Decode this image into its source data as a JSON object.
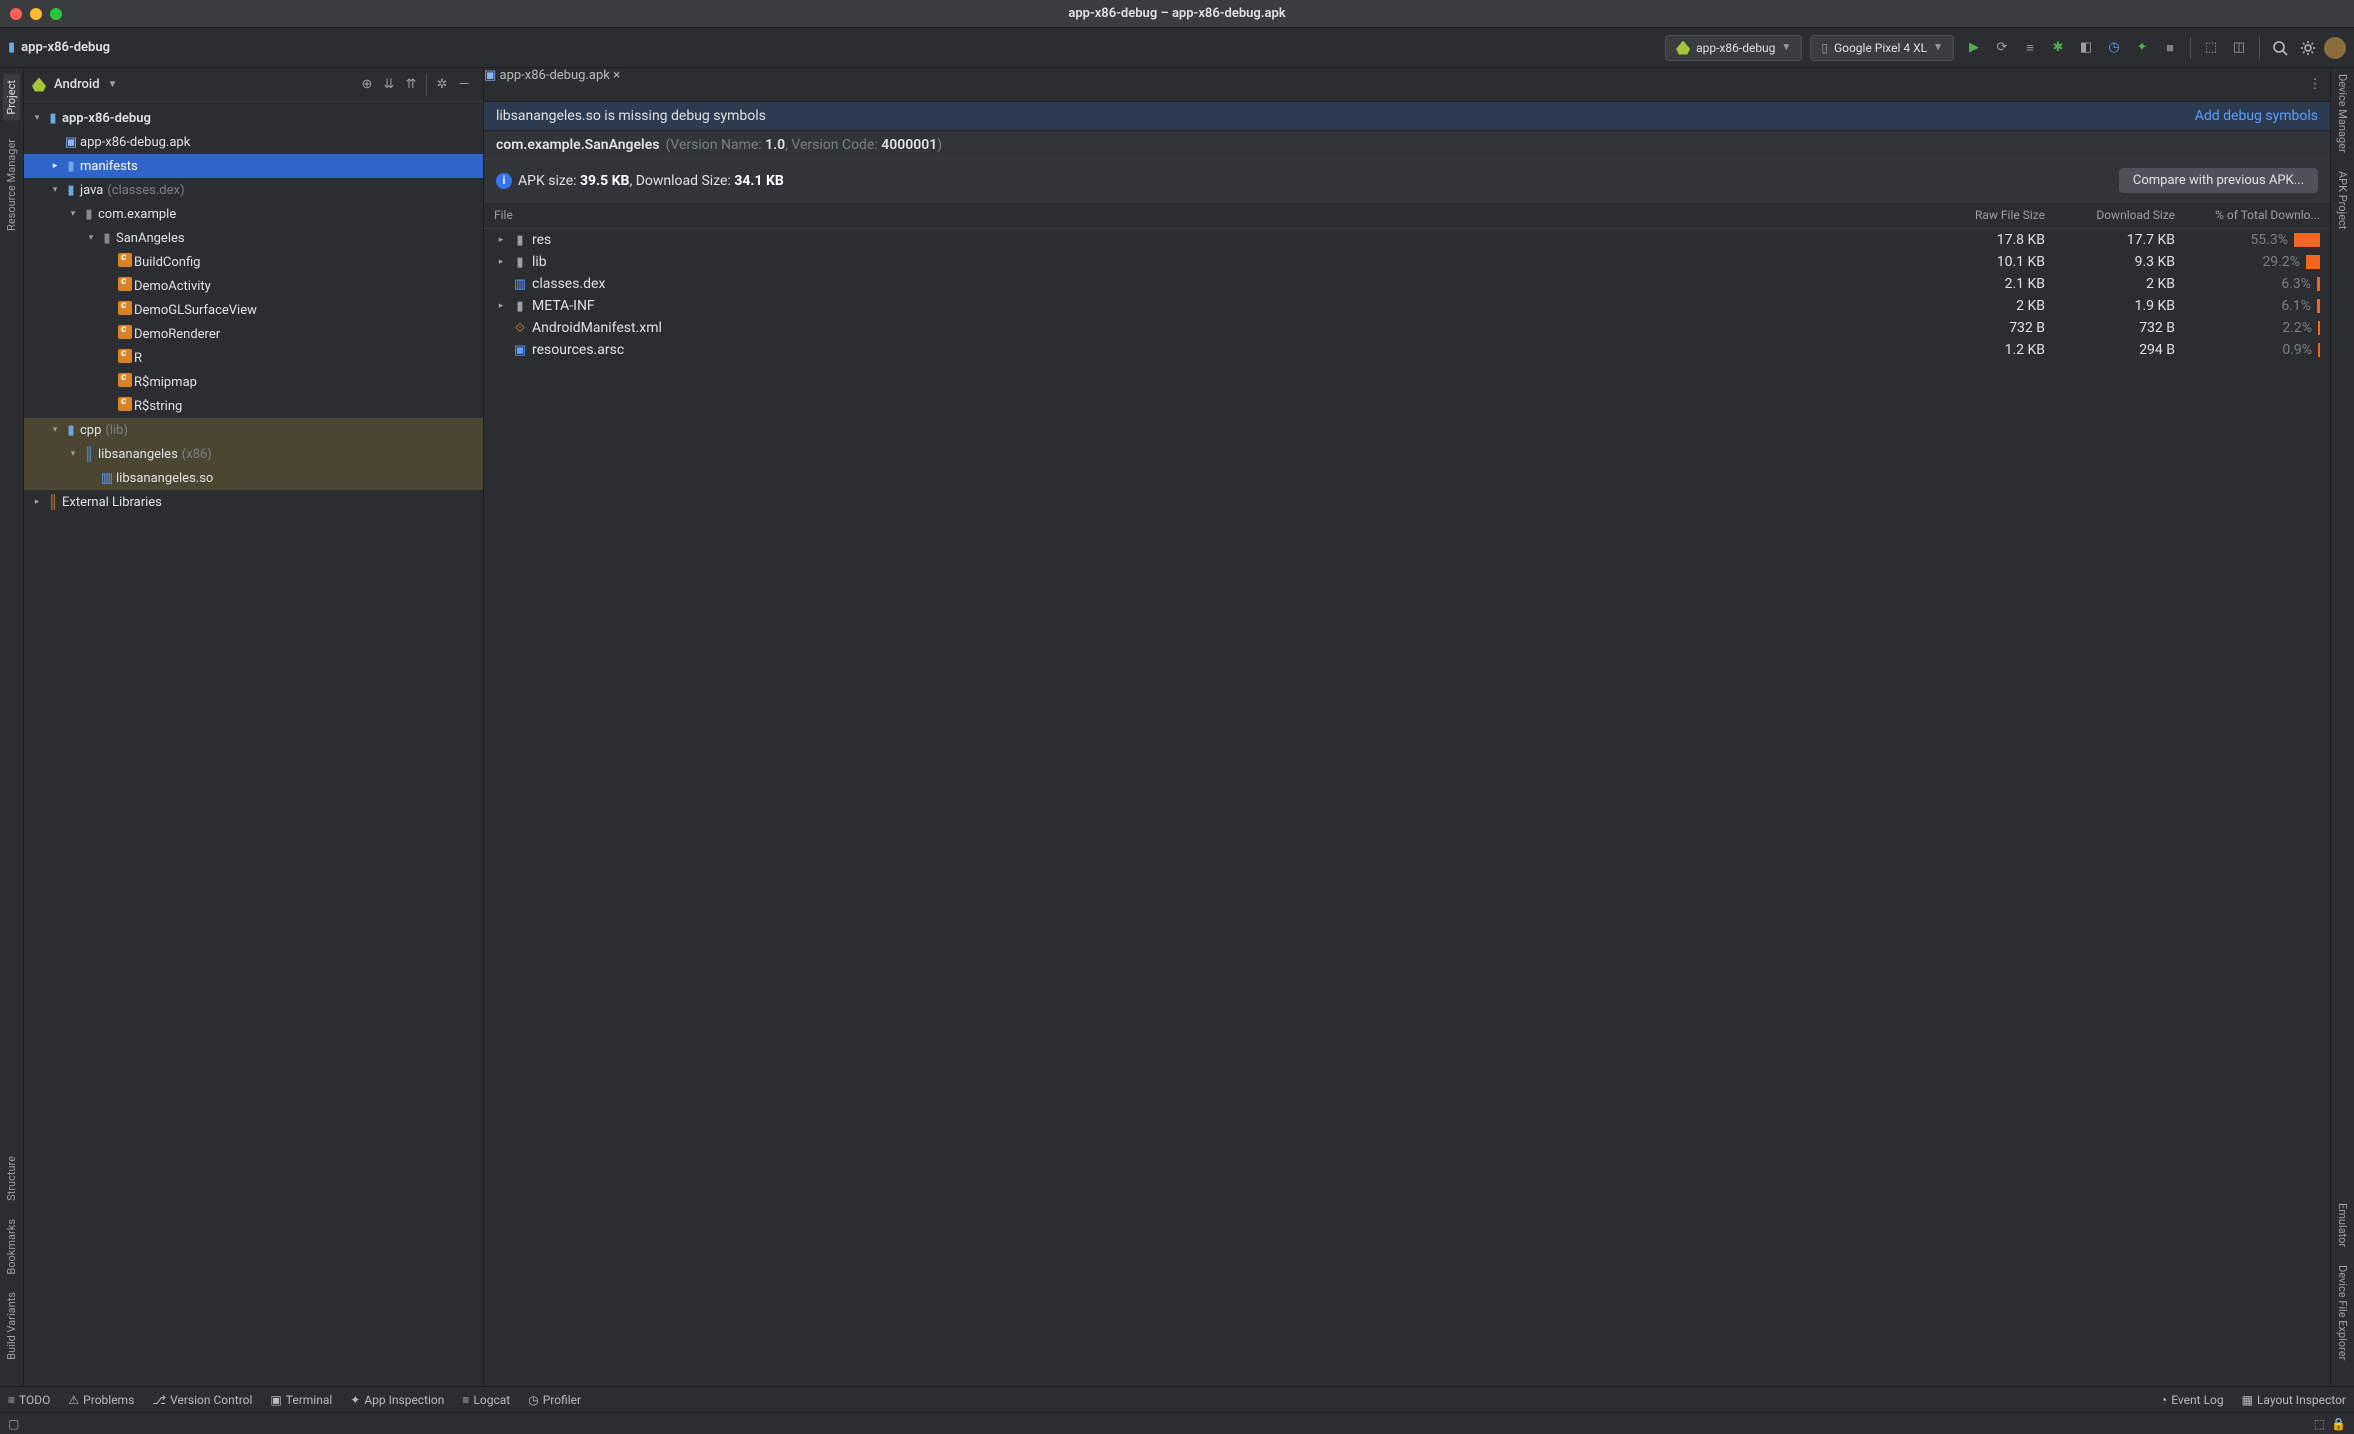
{
  "window": {
    "title": "app-x86-debug – app-x86-debug.apk",
    "breadcrumb": "app-x86-debug"
  },
  "toolbar": {
    "config": "app-x86-debug",
    "device": "Google Pixel 4 XL"
  },
  "leftSidebar": {
    "project": "Project",
    "resources": "Resource Manager",
    "structure": "Structure",
    "bookmarks": "Bookmarks",
    "buildVariants": "Build Variants"
  },
  "rightSidebar": {
    "deviceManager": "Device Manager",
    "apkProject": "APK Project",
    "emulator": "Emulator",
    "deviceFileExplorer": "Device File Explorer"
  },
  "projectPanel": {
    "view": "Android"
  },
  "tree": {
    "root": "app-x86-debug",
    "apk": "app-x86-debug.apk",
    "manifests": "manifests",
    "java": "java",
    "javaDim": "(classes.dex)",
    "pkg1": "com.example",
    "pkg2": "SanAngeles",
    "cls1": "BuildConfig",
    "cls2": "DemoActivity",
    "cls3": "DemoGLSurfaceView",
    "cls4": "DemoRenderer",
    "cls5": "R",
    "cls6": "R$mipmap",
    "cls7": "R$string",
    "cpp": "cpp",
    "cppDim": "(lib)",
    "lib1": "libsanangeles",
    "lib1Dim": "(x86)",
    "sofile": "libsanangeles.so",
    "extLibs": "External Libraries"
  },
  "editor": {
    "tabName": "app-x86-debug.apk",
    "bannerMsg": "libsanangeles.so is missing debug symbols",
    "bannerAction": "Add debug symbols",
    "packageName": "com.example.SanAngeles",
    "versionLabel": "(Version Name: ",
    "versionName": "1.0",
    "versionMid": ", Version Code: ",
    "versionCode": "4000001",
    "versionEnd": ")",
    "sizeLabelA": "APK size: ",
    "apkSize": "39.5 KB",
    "sizeLabelB": ", Download Size: ",
    "dlSize": "34.1 KB",
    "compareBtn": "Compare with previous APK..."
  },
  "table": {
    "h1": "File",
    "h2": "Raw File Size",
    "h3": "Download Size",
    "h4": "% of Total Downlo...",
    "rows": [
      {
        "expandable": true,
        "icon": "folder",
        "name": "res",
        "raw": "17.8 KB",
        "dl": "17.7 KB",
        "pct": "55.3%",
        "bar": 26
      },
      {
        "expandable": true,
        "icon": "folder",
        "name": "lib",
        "raw": "10.1 KB",
        "dl": "9.3 KB",
        "pct": "29.2%",
        "bar": 14
      },
      {
        "expandable": false,
        "icon": "dex",
        "name": "classes.dex",
        "raw": "2.1 KB",
        "dl": "2 KB",
        "pct": "6.3%",
        "bar": 3
      },
      {
        "expandable": true,
        "icon": "folder",
        "name": "META-INF",
        "raw": "2 KB",
        "dl": "1.9 KB",
        "pct": "6.1%",
        "bar": 3
      },
      {
        "expandable": false,
        "icon": "xml",
        "name": "AndroidManifest.xml",
        "raw": "732 B",
        "dl": "732 B",
        "pct": "2.2%",
        "bar": 2
      },
      {
        "expandable": false,
        "icon": "arsc",
        "name": "resources.arsc",
        "raw": "1.2 KB",
        "dl": "294 B",
        "pct": "0.9%",
        "bar": 0
      }
    ]
  },
  "footer": {
    "todo": "TODO",
    "problems": "Problems",
    "vcs": "Version Control",
    "terminal": "Terminal",
    "appInspection": "App Inspection",
    "logcat": "Logcat",
    "profiler": "Profiler",
    "eventLog": "Event Log",
    "layoutInspector": "Layout Inspector"
  }
}
